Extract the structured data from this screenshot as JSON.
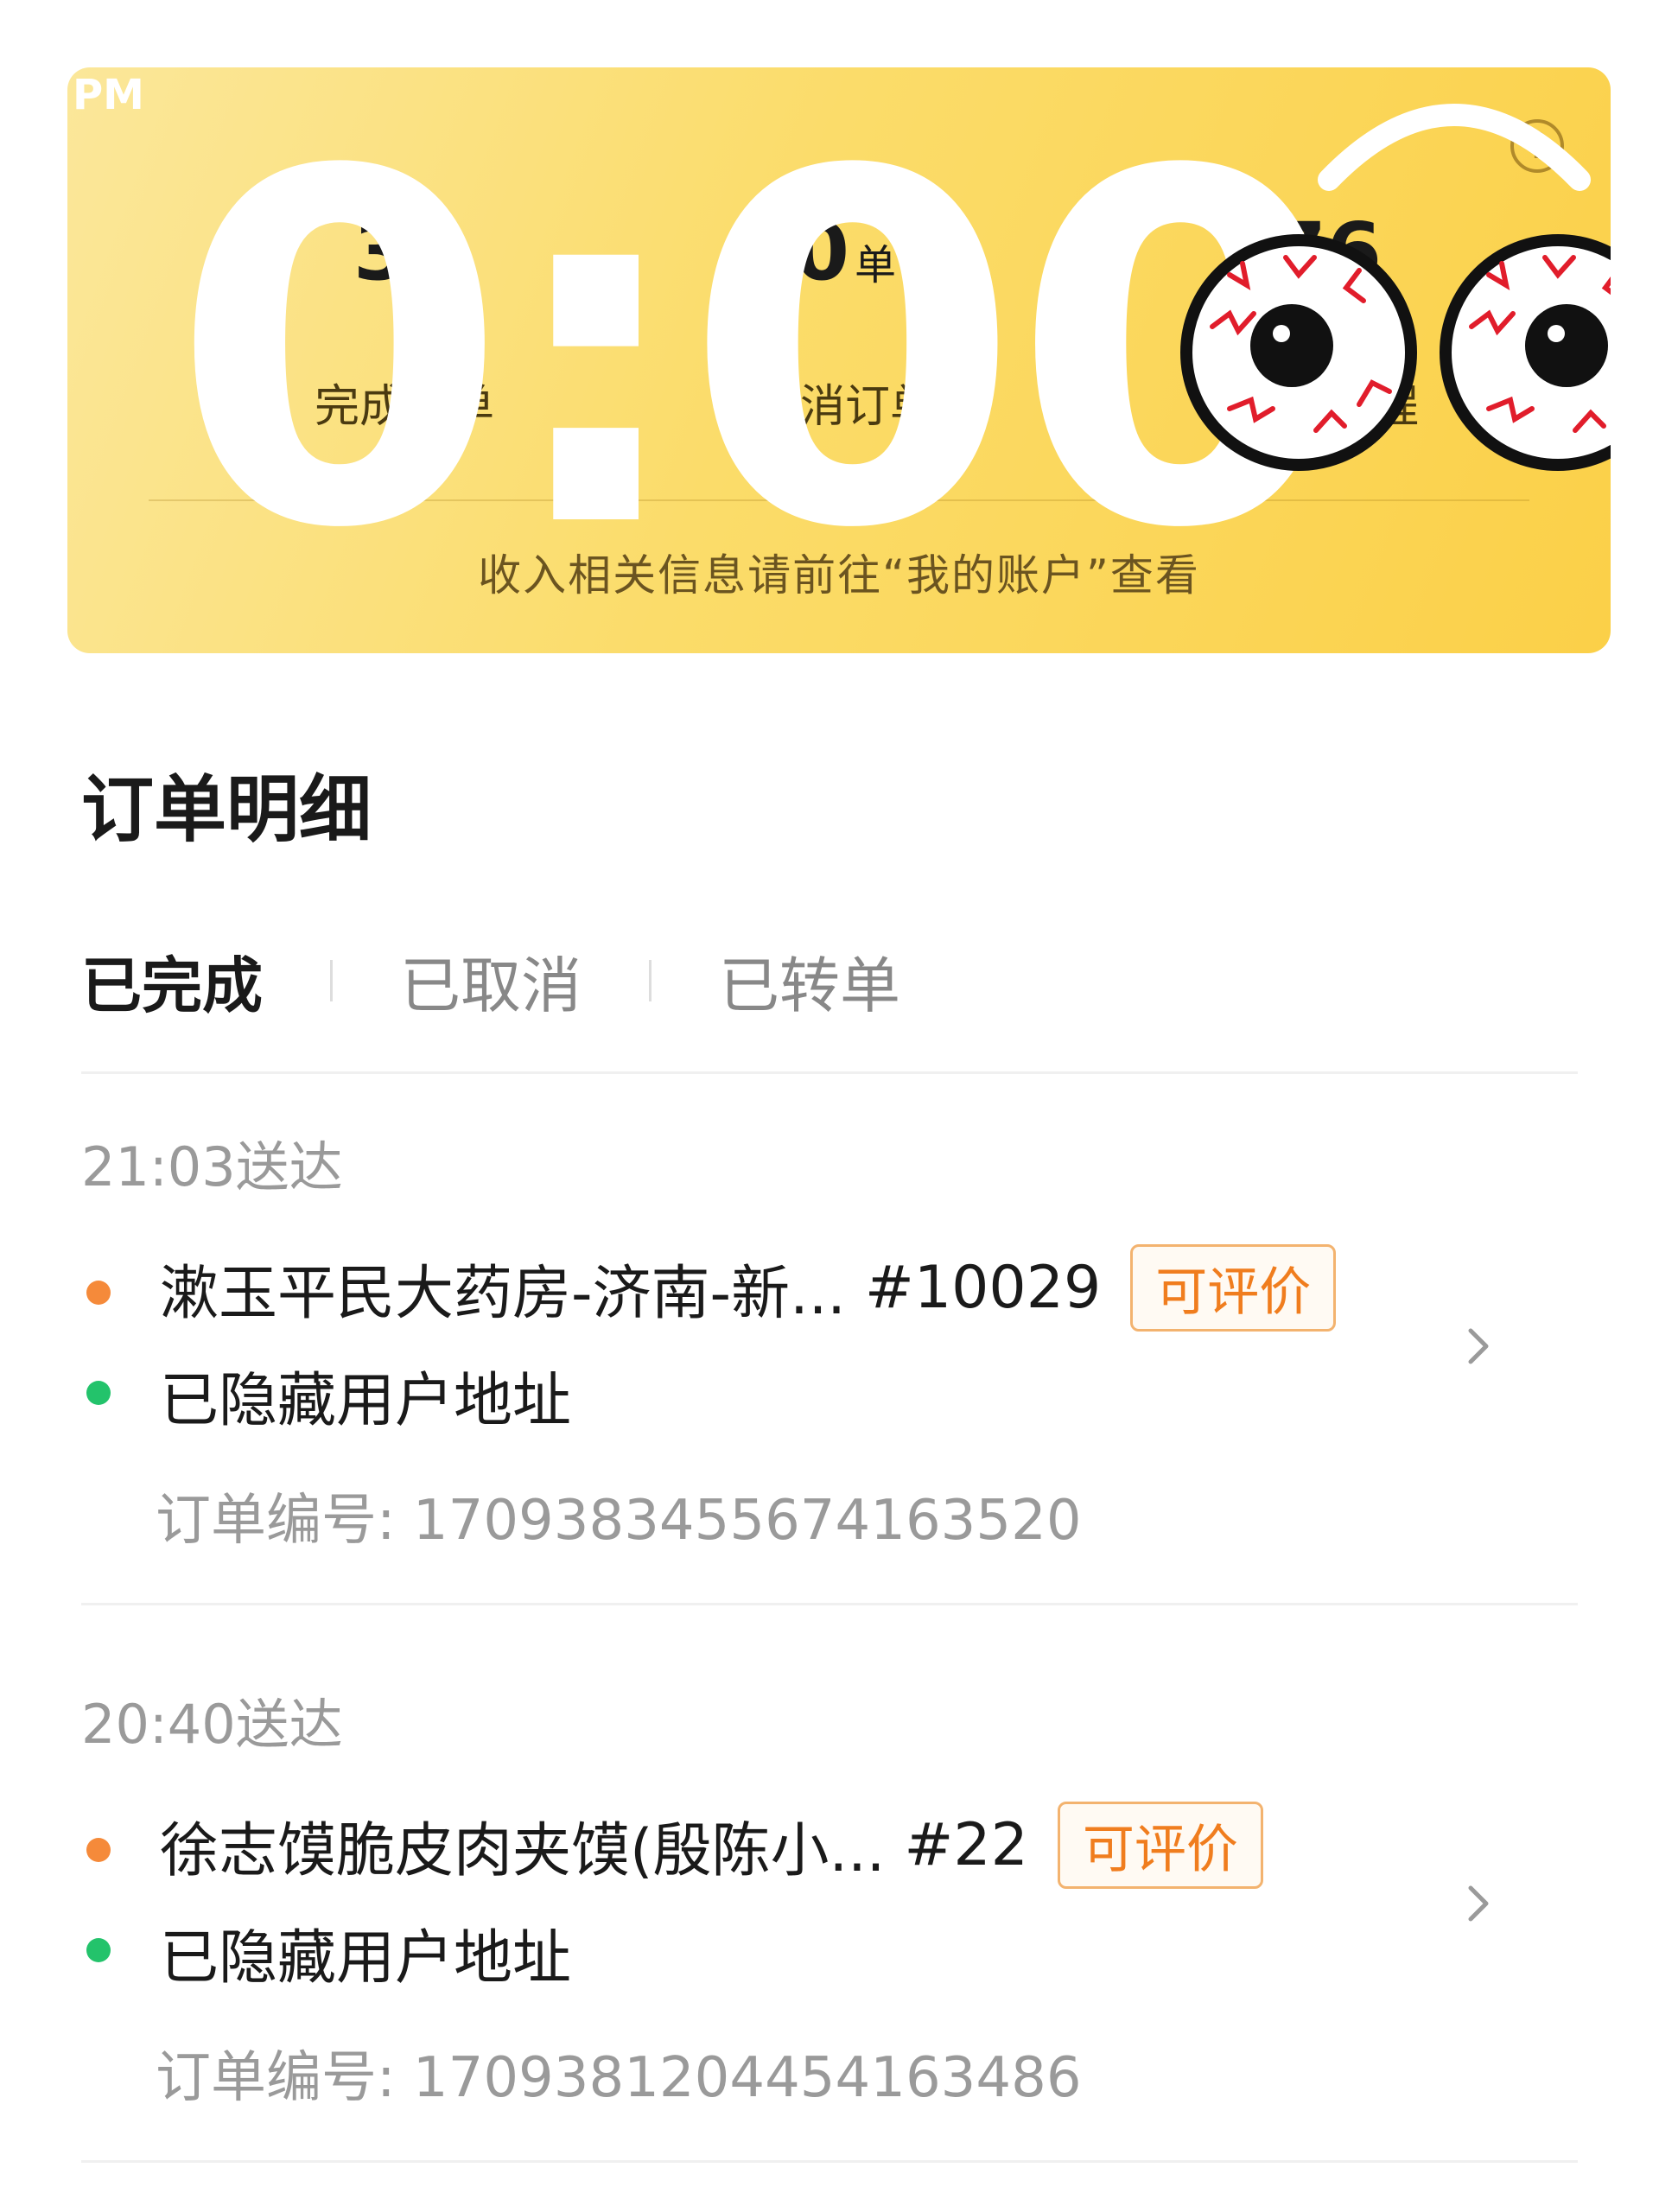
{
  "summary": {
    "stats": [
      {
        "value": "3",
        "unit": "单",
        "label": "完成订单"
      },
      {
        "value": "0",
        "unit": "单",
        "label": "取消订单"
      },
      {
        "value": "76",
        "unit": "",
        "label": "配送里程"
      }
    ],
    "note": "收入相关信息请前往“我的账户”查看",
    "help_icon": "question-circle-icon",
    "overlay_clock": "0:00",
    "overlay_ampm": "PM"
  },
  "section": {
    "title": "订单明细"
  },
  "tabs": [
    {
      "label": "已完成",
      "active": true
    },
    {
      "label": "已取消",
      "active": false
    },
    {
      "label": "已转单",
      "active": false
    }
  ],
  "orders": [
    {
      "delivered_time": "21:03送达",
      "shop_name": "漱玉平民大药房-济南-新...",
      "shop_no": "#10029",
      "rate_label": "可评价",
      "address": "已隐藏用户地址",
      "order_id": "订单编号: 1709383455674163520"
    },
    {
      "delivered_time": "20:40送达",
      "shop_name": "徐志馍脆皮肉夹馍(殷陈小...",
      "shop_no": "#22",
      "rate_label": "可评价",
      "address": "已隐藏用户地址",
      "order_id": "订单编号: 1709381204454163486"
    }
  ],
  "colors": {
    "card_yellow": "#fbdc6a",
    "accent_orange": "#f07d1e",
    "dot_orange": "#f58a3a",
    "dot_green": "#23c36b"
  }
}
